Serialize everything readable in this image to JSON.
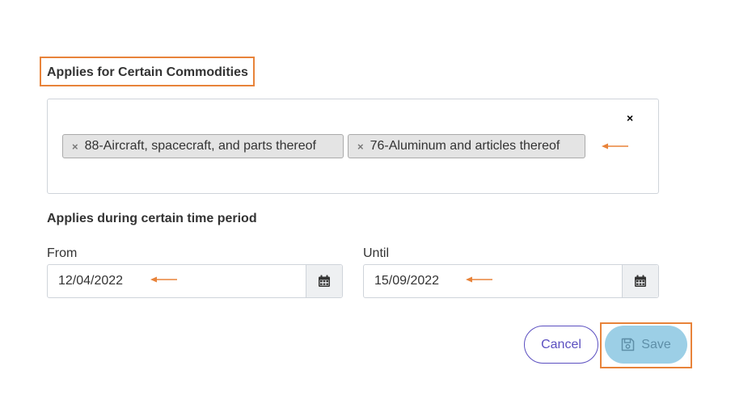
{
  "commodities": {
    "title": "Applies for Certain Commodities",
    "clear_all": "×",
    "chips": [
      {
        "label": "88-Aircraft, spacecraft, and parts thereof",
        "remove": "×"
      },
      {
        "label": "76-Aluminum and articles thereof",
        "remove": "×"
      }
    ]
  },
  "time_period": {
    "title": "Applies during certain time period",
    "from_label": "From",
    "from_value": "12/04/2022",
    "until_label": "Until",
    "until_value": "15/09/2022"
  },
  "actions": {
    "cancel_label": "Cancel",
    "save_label": "Save"
  },
  "icons": {
    "calendar": "calendar-icon",
    "save": "floppy-disk-icon",
    "annotation_arrow": "left-arrow-icon"
  },
  "colors": {
    "highlight": "#e8833a",
    "primary": "#5b4fc0",
    "save_bg": "#9ccfe6"
  }
}
